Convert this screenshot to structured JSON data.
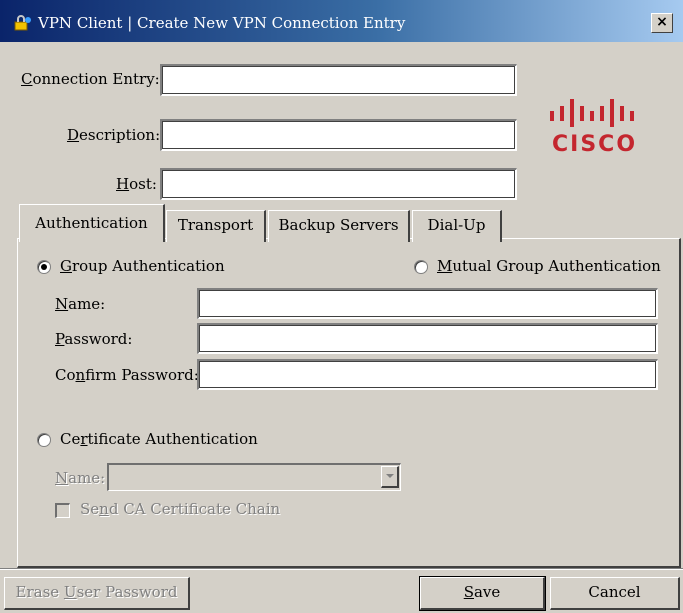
{
  "window": {
    "title": "VPN Client  |  Create New VPN Connection Entry",
    "close_glyph": "×"
  },
  "form": {
    "connection_entry": {
      "label_pre": "",
      "label_key": "C",
      "label_post": "onnection Entry:",
      "value": ""
    },
    "description": {
      "label_pre": "",
      "label_key": "D",
      "label_post": "escription:",
      "value": ""
    },
    "host": {
      "label_pre": "",
      "label_key": "H",
      "label_post": "ost:",
      "value": ""
    }
  },
  "logo": {
    "text": "CISCO",
    "color": "#c4262e"
  },
  "tabs": [
    {
      "label": "Authentication",
      "active": true
    },
    {
      "label": "Transport",
      "active": false
    },
    {
      "label": "Backup Servers",
      "active": false
    },
    {
      "label": "Dial-Up",
      "active": false
    }
  ],
  "auth": {
    "group_radio": {
      "label_pre": "",
      "label_key": "G",
      "label_post": "roup Authentication",
      "selected": true
    },
    "mutual_radio": {
      "label_pre": "",
      "label_key": "M",
      "label_post": "utual Group Authentication",
      "selected": false
    },
    "name": {
      "label_pre": "",
      "label_key": "N",
      "label_post": "ame:",
      "value": ""
    },
    "password": {
      "label_pre": "",
      "label_key": "P",
      "label_post": "assword:",
      "value": ""
    },
    "confirm": {
      "label_pre": "Co",
      "label_key": "n",
      "label_post": "firm Password:",
      "value": ""
    },
    "cert_radio": {
      "label_pre": "Ce",
      "label_key": "r",
      "label_post": "tificate Authentication",
      "selected": false
    },
    "cert_name": {
      "label_pre": "",
      "label_key": "N",
      "label_post": "ame:",
      "value": ""
    },
    "send_ca": {
      "label_pre": "Se",
      "label_key": "n",
      "label_post": "d CA Certificate Chain",
      "checked": false
    }
  },
  "buttons": {
    "erase": {
      "label_pre": "Erase ",
      "label_key": "U",
      "label_post": "ser Password"
    },
    "save": {
      "label_pre": "",
      "label_key": "S",
      "label_post": "ave"
    },
    "cancel": {
      "label": "Cancel"
    }
  },
  "colors": {
    "title_start": "#0a246a",
    "title_end": "#a6caf0",
    "face": "#d4d0c8"
  }
}
